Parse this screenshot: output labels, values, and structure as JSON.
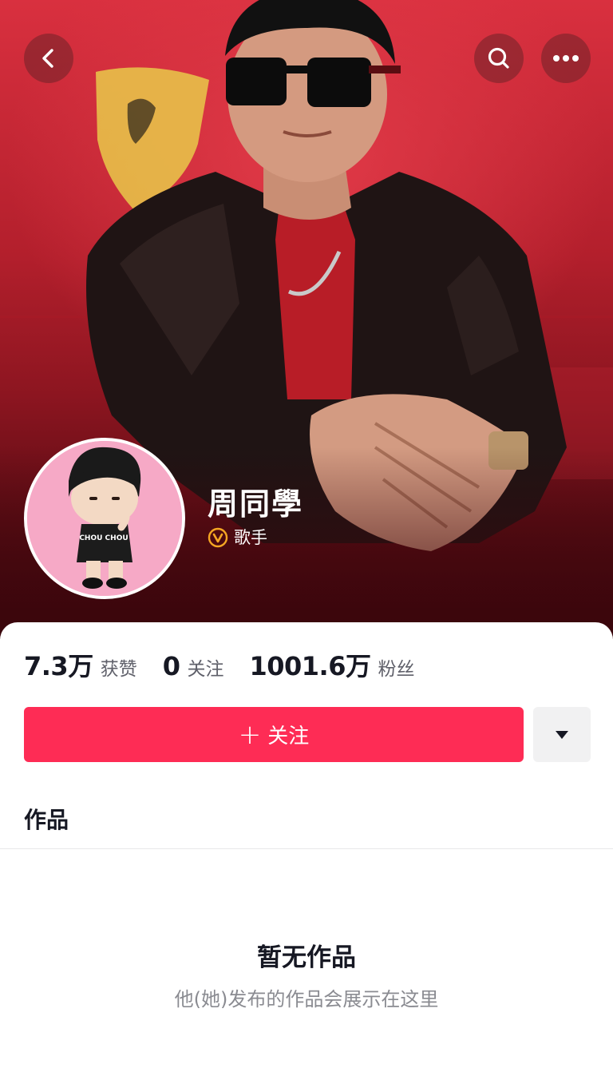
{
  "profile": {
    "name": "周同學",
    "verification": "歌手"
  },
  "stats": [
    {
      "value": "7.3万",
      "label": "获赞"
    },
    {
      "value": "0",
      "label": "关注"
    },
    {
      "value": "1001.6万",
      "label": "粉丝"
    }
  ],
  "actions": {
    "follow_plus": "+",
    "follow_label": "关注"
  },
  "tabs": {
    "works": "作品"
  },
  "empty_state": {
    "title": "暂无作品",
    "description": "他(她)发布的作品会展示在这里"
  },
  "avatar_shirt_text": "CHOU CHOU",
  "icons": {
    "back": "chevron-left-icon",
    "search": "search-icon",
    "more": "more-horizontal-icon",
    "verified": "verified-badge-icon",
    "dropdown": "caret-down-icon"
  },
  "colors": {
    "accent": "#fe2c55",
    "verified_badge": "#f5a623",
    "cover_red": "#c8202e",
    "text_primary": "#161823",
    "text_secondary": "#8a8b91"
  }
}
